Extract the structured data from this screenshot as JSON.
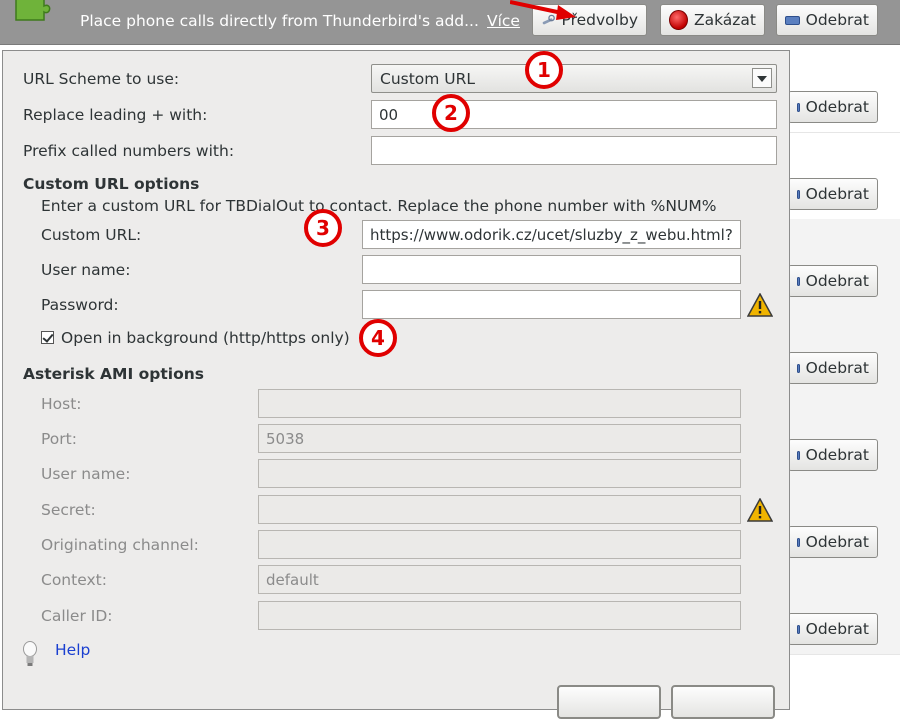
{
  "addon": {
    "description": "Place phone calls directly from Thunderbird's add...",
    "more_link": "Více",
    "preferences_button": "Předvolby",
    "disable_button": "Zakázat",
    "remove_button": "Odebrat"
  },
  "list": {
    "row_button": "Odebrat"
  },
  "form": {
    "url_scheme_label": "URL Scheme to use:",
    "url_scheme_value": "Custom URL",
    "replace_plus_label": "Replace leading + with:",
    "replace_plus_value": "00",
    "prefix_label": "Prefix called numbers with:",
    "prefix_value": ""
  },
  "custom_url": {
    "heading": "Custom URL options",
    "description": "Enter a custom URL for TBDialOut to contact. Replace the phone number with %NUM%",
    "url_label": "Custom URL:",
    "url_value": "https://www.odorik.cz/ucet/sluzby_z_webu.html?",
    "username_label": "User name:",
    "username_value": "",
    "password_label": "Password:",
    "password_value": "",
    "open_background_label": "Open in background (http/https only)",
    "open_background_checked": true
  },
  "asterisk": {
    "heading": "Asterisk AMI options",
    "host_label": "Host:",
    "host_value": "",
    "port_label": "Port:",
    "port_value": "5038",
    "username_label": "User name:",
    "username_value": "",
    "secret_label": "Secret:",
    "secret_value": "",
    "channel_label": "Originating channel:",
    "channel_value": "",
    "context_label": "Context:",
    "context_value": "default",
    "callerid_label": "Caller ID:",
    "callerid_value": ""
  },
  "help_link": "Help",
  "annotations": [
    "1",
    "2",
    "3",
    "4"
  ],
  "colors": {
    "annotation_red": "#e00000",
    "header_gray": "#959595",
    "dialog_bg": "#edeceb",
    "link_blue": "#1a3fd0"
  },
  "icons": [
    "puzzle-icon",
    "tools-icon",
    "red-stop-icon",
    "remove-icon",
    "warning-icon",
    "lightbulb-icon",
    "dropdown-arrow-icon",
    "checkmark-icon"
  ]
}
